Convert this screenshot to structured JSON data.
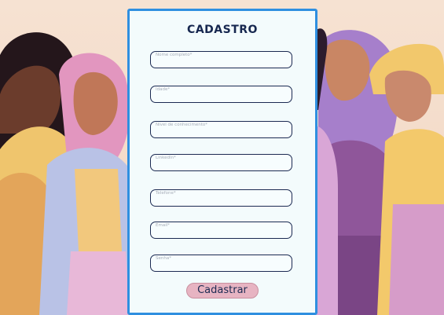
{
  "form": {
    "title": "CADASTRO",
    "fields": [
      {
        "label": "Nome completo*"
      },
      {
        "label": "Idade*"
      },
      {
        "label": "Nível de conhecimento*"
      },
      {
        "label": "LinkedIn*"
      },
      {
        "label": "Telefone*"
      },
      {
        "label": "Email*"
      },
      {
        "label": "Senha*"
      }
    ],
    "submit_label": "Cadastrar"
  },
  "colors": {
    "card_border": "#2f8fe0",
    "card_background": "#f3fbfc",
    "field_border": "#1c2a52",
    "button_background": "#e7b4c2",
    "title": "#16274f"
  }
}
